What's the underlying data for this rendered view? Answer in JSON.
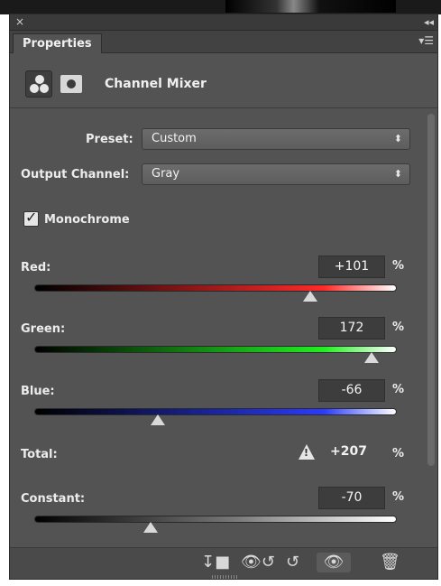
{
  "window": {
    "close_glyph": "×",
    "collapse_glyph": "◂◂"
  },
  "tab": {
    "title": "Properties",
    "menu_glyph": "▾☰"
  },
  "header": {
    "title": "Channel Mixer"
  },
  "preset": {
    "label": "Preset:",
    "value": "Custom"
  },
  "output_channel": {
    "label": "Output Channel:",
    "value": "Gray"
  },
  "monochrome": {
    "label": "Monochrome",
    "checked": true
  },
  "sliders": {
    "red": {
      "label": "Red:",
      "value": "+101",
      "percent": "%",
      "level": 0.76,
      "color": "#ff2a2a"
    },
    "green": {
      "label": "Green:",
      "value": "172",
      "percent": "%",
      "level": 0.93,
      "color": "#22ee22"
    },
    "blue": {
      "label": "Blue:",
      "value": "-66",
      "percent": "%",
      "level": 0.34,
      "color": "#2a3aff"
    }
  },
  "total": {
    "label": "Total:",
    "warning_glyph": "!",
    "value": "+207",
    "percent": "%"
  },
  "constant": {
    "label": "Constant:",
    "value": "-70",
    "percent": "%",
    "level": 0.32
  },
  "footer": {
    "clip_glyph": "↧■",
    "view_previous_glyph": "👁↺",
    "reset_glyph": "↺",
    "visibility_glyph": "👁",
    "delete_glyph": "🗑"
  }
}
